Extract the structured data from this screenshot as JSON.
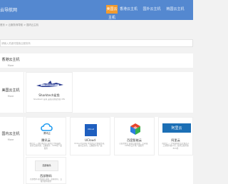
{
  "header": {
    "title": "云导航网",
    "nav": [
      "美国云主机",
      "香港云主机",
      "国外云主机",
      "韩国云主机"
    ],
    "active_index": 0
  },
  "breadcrumb": "首页 > 云服务商导航 > 国内云主机",
  "search": {
    "placeholder": "请输入关键词搜索云服务商"
  },
  "sections": [
    {
      "name": "香港云主机",
      "more": "More"
    },
    {
      "name": "美国云主机",
      "more": "More"
    },
    {
      "name": "国内云主机",
      "more": "More"
    }
  ],
  "cards": [
    {
      "name": "Sharktech鲨鱼",
      "desc": "Sharktech 鲨鱼 美国高防服务器 VPS",
      "logo_text": "SHARKTECH",
      "logo_color": "#2a3a8f"
    },
    {
      "name": "腾讯云",
      "desc": "腾讯云 — 腾讯倾力打造的云计算品牌，提供云服务器、云数据库、CDN等产品服务",
      "logo_text": "腾讯云",
      "logo_color": "#1e9bf0"
    },
    {
      "name": "UCloud",
      "desc": "UCloud 优刻得 中立的云计算服务商，提供云主机、云数据库等产品",
      "logo_text": "UCloud",
      "logo_color": "#1f5fbf"
    },
    {
      "name": "百度智能云",
      "desc": "百度智能云 提供云服务器、云存储、CDN等云计算产品服务",
      "logo_text": "百度",
      "logo_color": "#e8452c"
    },
    {
      "name": "阿里云",
      "desc": "阿里云 — 全球领先的云计算及人工智能科技公司，提供云服务器ECS等",
      "logo_text": "阿里云",
      "logo_color": "#1c6fb5"
    },
    {
      "name": "西部数码",
      "desc": "西部数码 提供域名注册、虚拟主机、云服务器等服务",
      "logo_text": "西部数码",
      "logo_color": "#333333"
    }
  ]
}
